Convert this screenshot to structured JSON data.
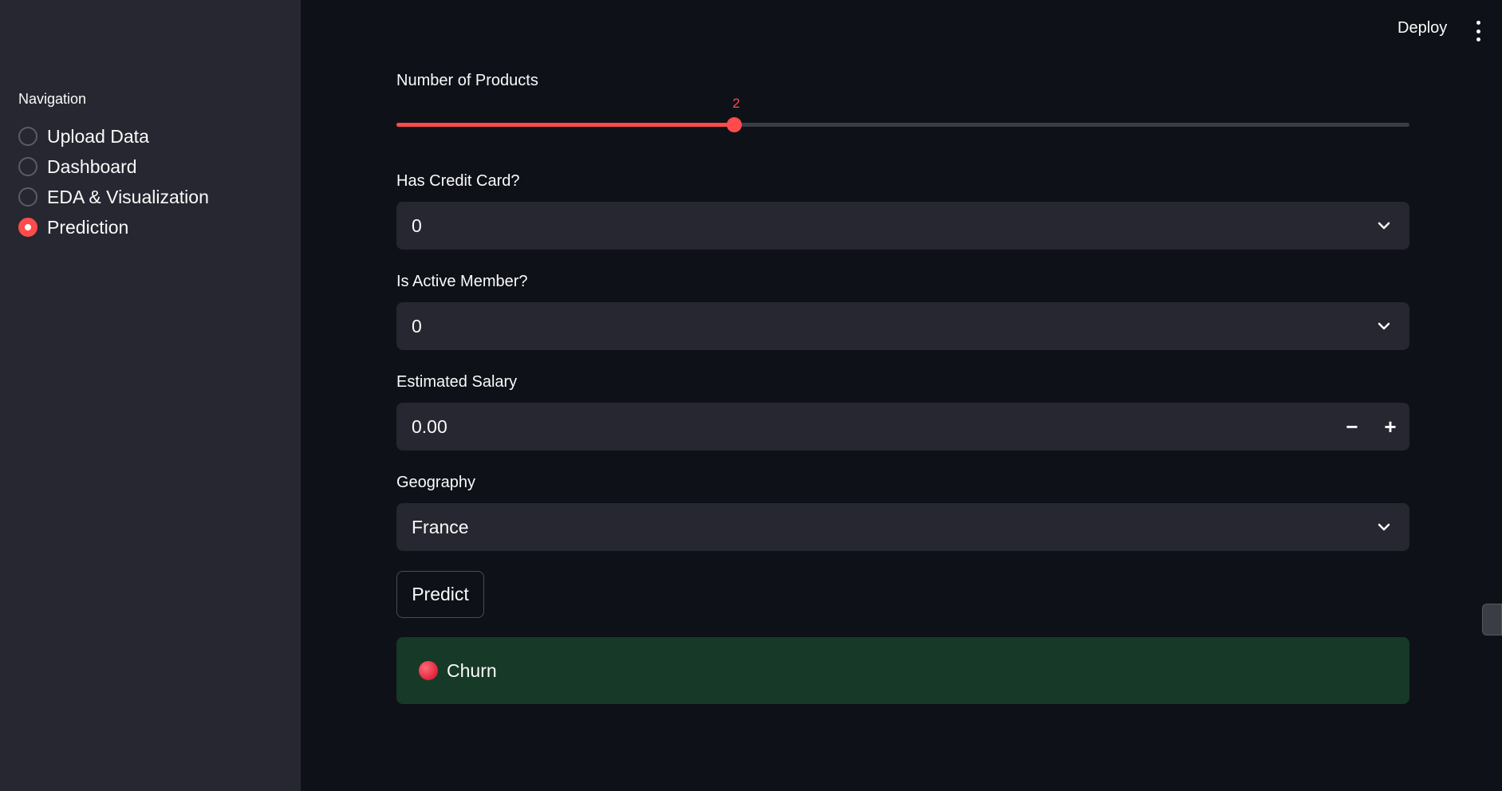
{
  "header": {
    "deploy_label": "Deploy",
    "menu_icon": "kebab-menu-icon"
  },
  "sidebar": {
    "title": "Navigation",
    "items": [
      {
        "label": "Upload Data",
        "selected": false
      },
      {
        "label": "Dashboard",
        "selected": false
      },
      {
        "label": "EDA & Visualization",
        "selected": false
      },
      {
        "label": "Prediction",
        "selected": true
      }
    ]
  },
  "form": {
    "num_products": {
      "label": "Number of Products",
      "value": "2",
      "fill_fraction": 0.333
    },
    "has_credit_card": {
      "label": "Has Credit Card?",
      "value": "0"
    },
    "is_active_member": {
      "label": "Is Active Member?",
      "value": "0"
    },
    "estimated_salary": {
      "label": "Estimated Salary",
      "value": "0.00",
      "minus": "−",
      "plus": "+"
    },
    "geography": {
      "label": "Geography",
      "value": "France"
    },
    "predict_label": "Predict"
  },
  "result": {
    "text": "Churn",
    "icon": "red-circle-icon"
  },
  "colors": {
    "accent": "#ff4b4b",
    "sidebar_bg": "#262730",
    "main_bg": "#0e1117",
    "success_bg": "#173928"
  }
}
